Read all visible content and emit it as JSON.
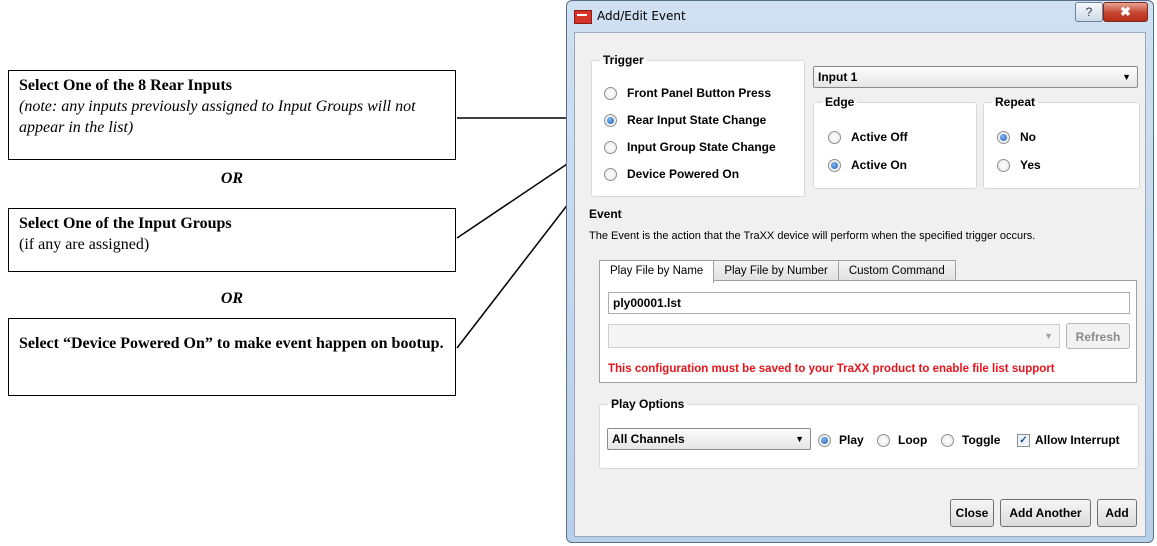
{
  "annotations": {
    "box1": {
      "title": "Select One of the 8 Rear Inputs",
      "note": "(note: any inputs previously assigned to Input Groups will not appear in the list)"
    },
    "or1": "OR",
    "box2": {
      "title": "Select One of the Input Groups",
      "note": "(if any are assigned)"
    },
    "or2": "OR",
    "box3": {
      "title": "Select “Device Powered On” to make event happen on bootup."
    }
  },
  "window": {
    "title": "Add/Edit Event",
    "help_label": "?",
    "close_label": "✖"
  },
  "trigger": {
    "label": "Trigger",
    "options": [
      {
        "label": "Front Panel Button Press",
        "selected": false
      },
      {
        "label": "Rear Input State Change",
        "selected": true
      },
      {
        "label": "Input Group State Change",
        "selected": false
      },
      {
        "label": "Device Powered On",
        "selected": false
      }
    ]
  },
  "input_select": {
    "value": "Input 1"
  },
  "edge": {
    "label": "Edge",
    "options": [
      {
        "label": "Active Off",
        "selected": false
      },
      {
        "label": "Active On",
        "selected": true
      }
    ]
  },
  "repeat": {
    "label": "Repeat",
    "options": [
      {
        "label": "No",
        "selected": true
      },
      {
        "label": "Yes",
        "selected": false
      }
    ]
  },
  "event": {
    "heading": "Event",
    "description": "The Event is the action that the TraXX device will perform when the specified trigger occurs.",
    "tabs": [
      {
        "label": "Play File by Name",
        "active": true
      },
      {
        "label": "Play File by Number",
        "active": false
      },
      {
        "label": "Custom Command",
        "active": false
      }
    ],
    "file_name": "ply00001.lst",
    "file_list_value": "",
    "refresh_label": "Refresh",
    "warning": "This configuration must be saved to your TraXX product to enable file list support"
  },
  "play_options": {
    "label": "Play Options",
    "channels": "All Channels",
    "modes": [
      {
        "label": "Play",
        "selected": true
      },
      {
        "label": "Loop",
        "selected": false
      },
      {
        "label": "Toggle",
        "selected": false
      }
    ],
    "allow_interrupt": {
      "label": "Allow Interrupt",
      "checked": true
    }
  },
  "buttons": {
    "close": "Close",
    "add_another": "Add Another",
    "add": "Add"
  },
  "colors": {
    "warning": "#e8141b",
    "radio_selected": "#1c5fb5",
    "title_bar": "#c9dcef"
  }
}
